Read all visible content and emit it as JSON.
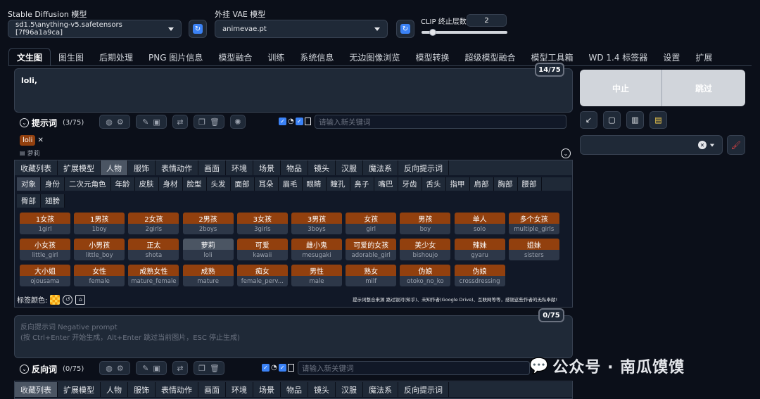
{
  "header": {
    "sd_model_label": "Stable Diffusion 模型",
    "sd_model_value": "sd1.5\\anything-v5.safetensors [7f96a1a9ca]",
    "vae_label": "外挂 VAE 模型",
    "vae_value": "animevae.pt",
    "clip_label": "CLIP 终止层数",
    "clip_value": "2",
    "clip_slider": 0.1
  },
  "tabs": [
    "文生图",
    "图生图",
    "后期处理",
    "PNG 图片信息",
    "模型融合",
    "训练",
    "系统信息",
    "无边图像浏览",
    "模型转换",
    "超级模型融合",
    "模型工具箱",
    "WD 1.4 标签器",
    "设置",
    "扩展"
  ],
  "prompt": {
    "text": "loli,",
    "counter": "14/75",
    "toolbar_label": "提示词",
    "toolbar_count": "(3/75)",
    "keyword_placeholder": "请输入新关键词",
    "chip_en": "loli",
    "chip_cn": "萝莉"
  },
  "categories": [
    "收藏列表",
    "扩展模型",
    "人物",
    "服饰",
    "表情动作",
    "画面",
    "环境",
    "场景",
    "物品",
    "镜头",
    "汉服",
    "魔法系",
    "反向提示词"
  ],
  "subcategories": [
    "对象",
    "身份",
    "二次元角色",
    "年龄",
    "皮肤",
    "身材",
    "脸型",
    "头发",
    "面部",
    "耳朵",
    "眉毛",
    "眼睛",
    "瞳孔",
    "鼻子",
    "嘴巴",
    "牙齿",
    "舌头",
    "指甲",
    "肩部",
    "胸部",
    "腰部"
  ],
  "subcategories2": [
    "臀部",
    "翅膀"
  ],
  "tag_rows": [
    [
      {
        "cn": "1女孩",
        "en": "1girl"
      },
      {
        "cn": "1男孩",
        "en": "1boy"
      },
      {
        "cn": "2女孩",
        "en": "2girls"
      },
      {
        "cn": "2男孩",
        "en": "2boys"
      },
      {
        "cn": "3女孩",
        "en": "3girls"
      },
      {
        "cn": "3男孩",
        "en": "3boys"
      },
      {
        "cn": "女孩",
        "en": "girl"
      },
      {
        "cn": "男孩",
        "en": "boy"
      },
      {
        "cn": "单人",
        "en": "solo"
      },
      {
        "cn": "多个女孩",
        "en": "multiple_girls"
      }
    ],
    [
      {
        "cn": "小女孩",
        "en": "little_girl"
      },
      {
        "cn": "小男孩",
        "en": "little_boy"
      },
      {
        "cn": "正太",
        "en": "shota"
      },
      {
        "cn": "萝莉",
        "en": "loli",
        "selected": true
      },
      {
        "cn": "可爱",
        "en": "kawaii"
      },
      {
        "cn": "雌小鬼",
        "en": "mesugaki"
      },
      {
        "cn": "可爱的女孩",
        "en": "adorable_girl"
      },
      {
        "cn": "美少女",
        "en": "bishoujo"
      },
      {
        "cn": "辣妹",
        "en": "gyaru"
      },
      {
        "cn": "姐妹",
        "en": "sisters"
      }
    ],
    [
      {
        "cn": "大小姐",
        "en": "ojousama"
      },
      {
        "cn": "女性",
        "en": "female"
      },
      {
        "cn": "成熟女性",
        "en": "mature_female"
      },
      {
        "cn": "成熟",
        "en": "mature"
      },
      {
        "cn": "痴女",
        "en": "female_perv..."
      },
      {
        "cn": "男性",
        "en": "male"
      },
      {
        "cn": "熟女",
        "en": "milf"
      },
      {
        "cn": "伪娘",
        "en": "otoko_no_ko"
      },
      {
        "cn": "伪娘",
        "en": "crossdressing"
      }
    ]
  ],
  "tag_color_label": "标签颜色:",
  "credits": "提示词整合来源 路过银河(知乎)、未知作者(Google Drive)、互联网等等，感谢这些作者的无私奉献!",
  "negative": {
    "placeholder_line1": "反向提示词 Negative prompt",
    "placeholder_line2": "(按 Ctrl+Enter 开始生成，Alt+Enter 跳过当前图片，ESC 停止生成)",
    "counter": "0/75",
    "toolbar_label": "反向词",
    "toolbar_count": "(0/75)",
    "keyword_placeholder": "请输入新关键词"
  },
  "side": {
    "interrupt": "中止",
    "skip": "跳过"
  },
  "watermark": "公众号 · 南瓜馍馍",
  "colors": {
    "tag_orange": "#92400e",
    "accent_blue": "#3b82f6"
  }
}
